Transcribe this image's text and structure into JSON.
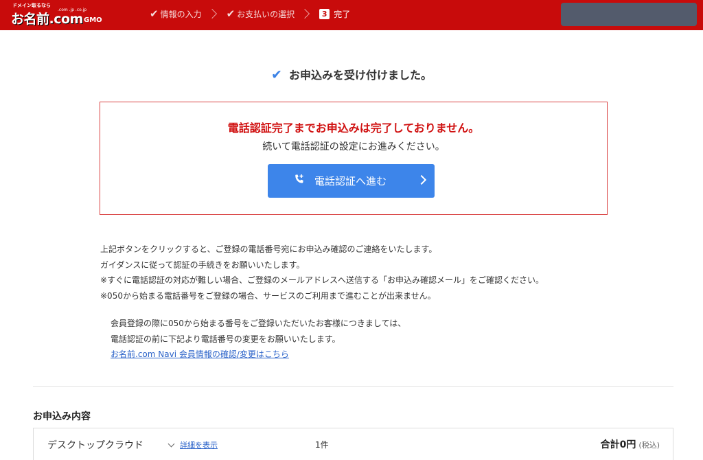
{
  "header": {
    "logo": {
      "tagline": "ドメイン取るなら",
      "tlds": ".com .jp .co.jp",
      "main": "お名前.com",
      "gmo": "GMO"
    },
    "steps": [
      {
        "label": "情報の入力",
        "status": "done"
      },
      {
        "label": "お支払いの選択",
        "status": "done"
      },
      {
        "number": "3",
        "label": "完了",
        "status": "current"
      }
    ],
    "colors": {
      "brand": "#c80b0b"
    }
  },
  "main": {
    "done_title": "お申込みを受け付けました。",
    "alert": {
      "title": "電話認証完了までお申込みは完了しておりません。",
      "subtitle": "続いて電話認証の設定にお進みください。",
      "button_label": "電話認証へ進む",
      "button_color": "#3d85ea"
    },
    "notes": [
      "上記ボタンをクリックすると、ご登録の電話番号宛にお申込み確認のご連絡をいたします。",
      "ガイダンスに従って認証の手続きをお願いいたします。",
      "※すぐに電話認証の対応が難しい場合、ご登録のメールアドレスへ送信する「お申込み確認メール」をご確認ください。",
      "※050から始まる電話番号をご登録の場合、サービスのご利用まで進むことが出来ません。"
    ],
    "sub_notes": [
      "会員登録の際に050から始まる番号をご登録いただいたお客様につきましては、",
      "電話認証の前に下記より電話番号の変更をお願いいたします。"
    ],
    "navi_link": "お名前.com Navi 会員情報の確認/変更はこちら"
  },
  "order": {
    "heading": "お申込み内容",
    "items": [
      {
        "name": "デスクトップクラウド",
        "detail_link": "詳細を表示",
        "quantity": "1件",
        "total": "合計0円",
        "tax_note": "(税込)"
      }
    ]
  }
}
